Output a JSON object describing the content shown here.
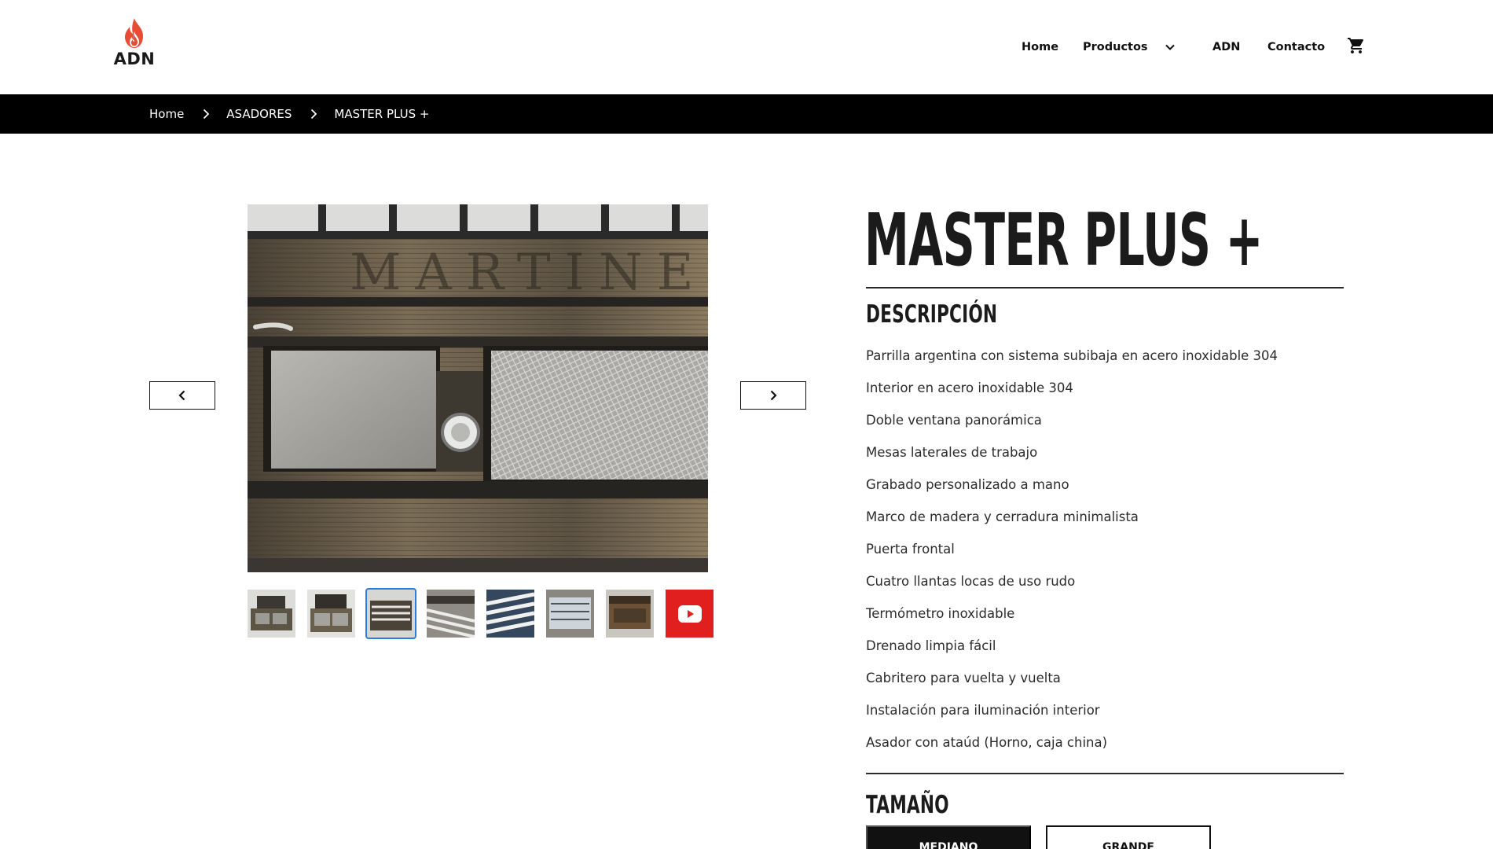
{
  "brand": {
    "name": "ADN",
    "flame_color": "#e94b34"
  },
  "nav": {
    "home": "Home",
    "products": "Productos",
    "adn": "ADN",
    "contact": "Contacto",
    "cart_icon": "cart-icon"
  },
  "breadcrumb": {
    "items": [
      "Home",
      "ASADORES",
      "MASTER PLUS +"
    ]
  },
  "gallery": {
    "thumbnail_count": 8,
    "selected_index": 2,
    "last_is_video": true
  },
  "product": {
    "title": "MASTER PLUS +",
    "description_heading": "DESCRIPCIÓN",
    "features": [
      "Parrilla argentina con sistema subibaja en acero inoxidable 304",
      "Interior en acero inoxidable 304",
      "Doble ventana panorámica",
      "Mesas laterales de trabajo",
      "Grabado personalizado a mano",
      "Marco de madera y cerradura minimalista",
      "Puerta frontal",
      "Cuatro llantas locas de uso rudo",
      "Termómetro inoxidable",
      "Drenado limpia fácil",
      "Cabritero para vuelta y vuelta",
      "Instalación para iluminación interior",
      "Asador con ataúd (Horno, caja china)"
    ],
    "size_heading": "TAMAÑO",
    "sizes": [
      "MEDIANO",
      "GRANDE"
    ],
    "selected_size": "MEDIANO"
  }
}
